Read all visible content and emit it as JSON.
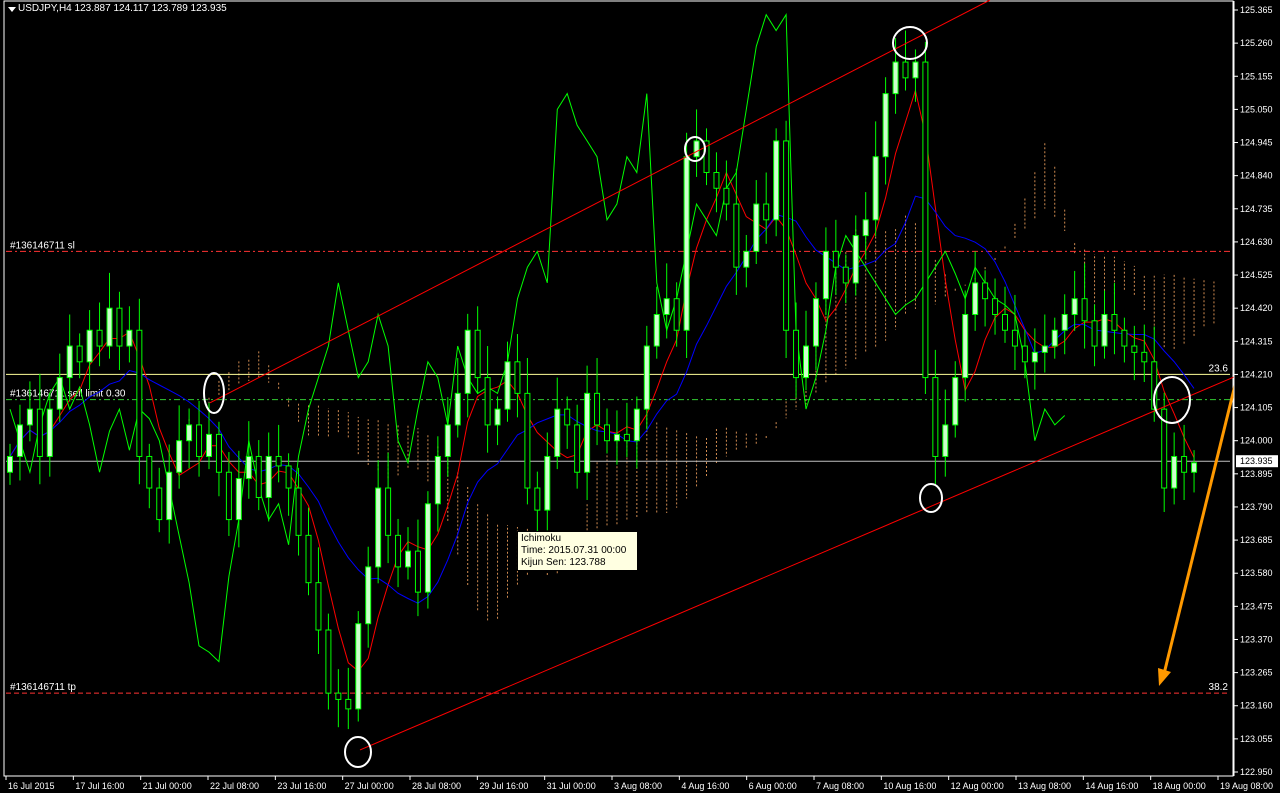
{
  "header": {
    "symbol_tf": "USDJPY,H4",
    "ohlc": "123.887 124.117 123.789 123.935"
  },
  "tooltip": {
    "title": "Ichimoku",
    "time": "Time: 2015.07.31 00:00",
    "kijun": "Kijun Sen: 123.788"
  },
  "level_labels": {
    "sl": "#136146711 sl",
    "sell_limit": "#136146711 sell limit 0.30",
    "tp": "#136146711 tp",
    "fib_23": "23.6",
    "fib_38": "38.2"
  },
  "colors": {
    "background": "#000000",
    "bull_candle": "#ccffcc",
    "bear_candle": "#000000",
    "wick": "#00ff00",
    "tenkan": "#ff0000",
    "kijun": "#0000ff",
    "chikou": "#00ff00",
    "cloud": "#f4a460",
    "channel": "#ff0000",
    "fib": "#ffff99",
    "arrow": "#ff9900",
    "price_line": "#ffffff"
  },
  "chart_data": {
    "type": "candlestick",
    "current_price": "123.935",
    "y_ticks": [
      "125.365",
      "125.260",
      "125.155",
      "125.050",
      "124.945",
      "124.840",
      "124.735",
      "124.630",
      "124.525",
      "124.420",
      "124.315",
      "124.210",
      "124.105",
      "124.000",
      "123.895",
      "123.790",
      "123.685",
      "123.580",
      "123.475",
      "123.370",
      "123.265",
      "123.160",
      "123.055",
      "122.950"
    ],
    "x_ticks": [
      "16 Jul 2015",
      "17 Jul 16:00",
      "21 Jul 00:00",
      "22 Jul 08:00",
      "23 Jul 16:00",
      "27 Jul 00:00",
      "28 Jul 08:00",
      "29 Jul 16:00",
      "31 Jul 00:00",
      "3 Aug 08:00",
      "4 Aug 16:00",
      "6 Aug 00:00",
      "7 Aug 08:00",
      "10 Aug 16:00",
      "12 Aug 00:00",
      "13 Aug 08:00",
      "14 Aug 16:00",
      "18 Aug 00:00",
      "19 Aug 08:00"
    ],
    "levels": {
      "sl": 124.6,
      "sell_limit": 124.13,
      "fib_23_6": 124.21,
      "tp": 123.2,
      "fib_38_2": 123.2
    },
    "price_range": [
      122.95,
      125.365
    ],
    "close_series": [
      123.95,
      124.05,
      124.1,
      123.95,
      124.1,
      124.2,
      124.3,
      124.25,
      124.35,
      124.3,
      124.42,
      124.3,
      124.35,
      123.95,
      123.85,
      123.75,
      123.9,
      124.0,
      124.05,
      123.95,
      124.02,
      123.9,
      123.75,
      123.88,
      123.95,
      123.82,
      123.95,
      123.92,
      123.85,
      123.7,
      123.55,
      123.4,
      123.2,
      123.18,
      123.15,
      123.42,
      123.6,
      123.85,
      123.7,
      123.6,
      123.65,
      123.52,
      123.8,
      123.95,
      124.05,
      124.15,
      124.35,
      124.2,
      124.05,
      124.1,
      124.25,
      124.15,
      123.85,
      123.78,
      123.95,
      124.1,
      124.05,
      123.9,
      124.15,
      124.05,
      124.0,
      124.02,
      124.0,
      124.1,
      124.3,
      124.4,
      124.45,
      124.35,
      124.9,
      124.95,
      124.85,
      124.8,
      124.75,
      124.55,
      124.6,
      124.75,
      124.7,
      124.95,
      124.35,
      124.2,
      124.3,
      124.45,
      124.6,
      124.55,
      124.5,
      124.65,
      124.7,
      124.9,
      125.1,
      125.2,
      125.15,
      125.2,
      124.2,
      123.95,
      124.05,
      124.2,
      124.4,
      124.5,
      124.45,
      124.4,
      124.35,
      124.3,
      124.25,
      124.28,
      124.3,
      124.35,
      124.4,
      124.45,
      124.38,
      124.3,
      124.4,
      124.35,
      124.3,
      124.28,
      124.25,
      124.1,
      123.85,
      123.95,
      123.9,
      123.93
    ]
  }
}
